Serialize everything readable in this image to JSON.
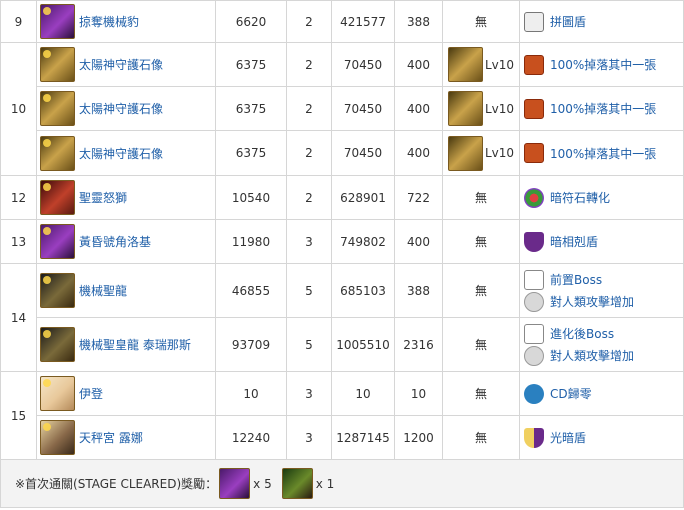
{
  "rows": [
    {
      "wave": "9",
      "name": "掠奪機械豹",
      "hp": "6620",
      "cd": "2",
      "atk": "421577",
      "def": "388",
      "drop": "無",
      "skills": [
        "拼圖盾"
      ]
    },
    {
      "wave": "10",
      "name": "太陽神守護石像",
      "hp": "6375",
      "cd": "2",
      "atk": "70450",
      "def": "400",
      "drop_lv": "Lv10",
      "skills": [
        "100%掉落其中一張"
      ]
    },
    {
      "name": "太陽神守護石像",
      "hp": "6375",
      "cd": "2",
      "atk": "70450",
      "def": "400",
      "drop_lv": "Lv10",
      "skills": [
        "100%掉落其中一張"
      ]
    },
    {
      "name": "太陽神守護石像",
      "hp": "6375",
      "cd": "2",
      "atk": "70450",
      "def": "400",
      "drop_lv": "Lv10",
      "skills": [
        "100%掉落其中一張"
      ]
    },
    {
      "wave": "12",
      "name": "聖靈怒獅",
      "hp": "10540",
      "cd": "2",
      "atk": "628901",
      "def": "722",
      "drop": "無",
      "skills": [
        "暗符石轉化"
      ]
    },
    {
      "wave": "13",
      "name": "黃昏號角洛基",
      "hp": "11980",
      "cd": "3",
      "atk": "749802",
      "def": "400",
      "drop": "無",
      "skills": [
        "暗相剋盾"
      ]
    },
    {
      "wave": "14",
      "name": "機械聖龍",
      "hp": "46855",
      "cd": "5",
      "atk": "685103",
      "def": "388",
      "drop": "無",
      "skills": [
        "前置Boss",
        "對人類攻擊增加"
      ]
    },
    {
      "name": "機械聖皇龍 泰瑞那斯",
      "hp": "93709",
      "cd": "5",
      "atk": "1005510",
      "def": "2316",
      "drop": "無",
      "skills": [
        "進化後Boss",
        "對人類攻擊增加"
      ]
    },
    {
      "wave": "15",
      "name": "伊登",
      "hp": "10",
      "cd": "3",
      "atk": "10",
      "def": "10",
      "drop": "無",
      "skills": [
        "CD歸零"
      ]
    },
    {
      "name": "天秤宮 露娜",
      "hp": "12240",
      "cd": "3",
      "atk": "1287145",
      "def": "1200",
      "drop": "無",
      "skills": [
        "光暗盾"
      ]
    }
  ],
  "footer": {
    "label": "※首次通關(STAGE CLEARED)獎勵：",
    "rewards": [
      {
        "count": "x 5"
      },
      {
        "count": "x 1"
      }
    ]
  },
  "icons": {
    "skill_puzzle": "puzzle-shield-icon",
    "skill_drop": "drop-card-icon",
    "skill_convert": "rune-convert-icon",
    "skill_dark_shield": "dark-shield-icon",
    "skill_boss": "boss-icon",
    "skill_human": "human-attack-icon",
    "skill_cd": "cd-reset-icon",
    "skill_ld_shield": "light-dark-shield-icon"
  }
}
